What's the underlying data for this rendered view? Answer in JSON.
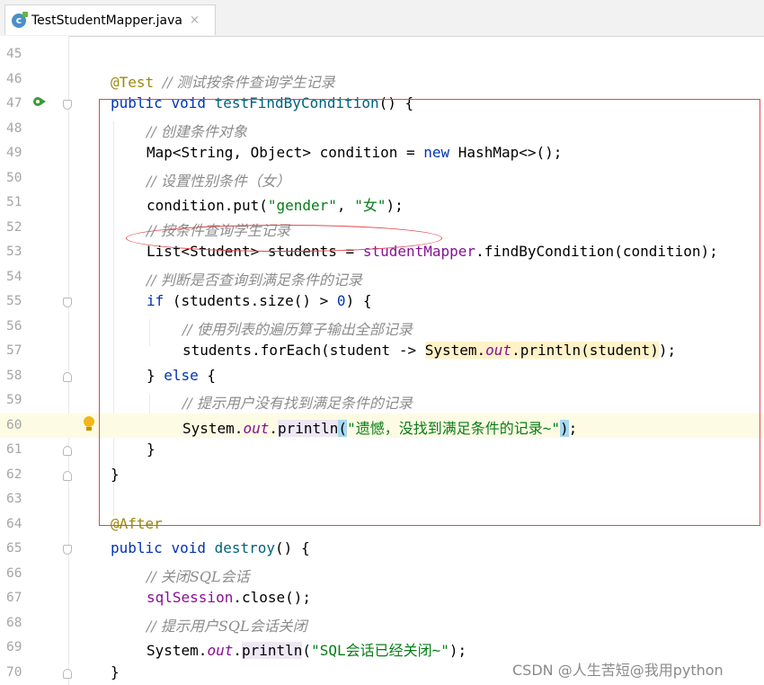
{
  "tab": {
    "filename": "TestStudentMapper.java",
    "icon_letter": "c",
    "close": "×"
  },
  "code": {
    "l46": {
      "num": "45"
    },
    "l47": {
      "num": "46",
      "ann": "@Test",
      "cmt": "// 测试按条件查询学生记录"
    },
    "l48": {
      "num": "47",
      "kw1": "public",
      "kw2": "void",
      "fn": "testFindByCondition",
      "rest": "() {"
    },
    "l49": {
      "num": "48",
      "cmt": "// 创建条件对象"
    },
    "l50": {
      "num": "49",
      "p1": "Map<String, Object> condition = ",
      "kw": "new",
      "p2": " HashMap<>();"
    },
    "l51": {
      "num": "50",
      "cmt": "// 设置性别条件（女）"
    },
    "l52": {
      "num": "51",
      "p1": "condition.put(",
      "s1": "\"gender\"",
      "p2": ", ",
      "s2": "\"女\"",
      "p3": ");"
    },
    "l53": {
      "num": "52",
      "cmt": "// 按条件查询学生记录"
    },
    "l54": {
      "num": "53",
      "p1": "List<Student> students = ",
      "fld": "studentMapper",
      "p2": ".findByCondition(condition);"
    },
    "l55": {
      "num": "54",
      "cmt": "// 判断是否查询到满足条件的记录"
    },
    "l56": {
      "num": "55",
      "kw": "if",
      "p1": " (students.size() > ",
      "n": "0",
      "p2": ") {"
    },
    "l57": {
      "num": "56",
      "cmt": "// 使用列表的遍历算子输出全部记录"
    },
    "l58": {
      "num": "57",
      "p1": "students.forEach(student -> ",
      "h1": "System.",
      "h2": "out",
      "h3": ".println(student)",
      "p2": ");"
    },
    "l59": {
      "num": "58",
      "p1": "} ",
      "kw": "else",
      "p2": " {"
    },
    "l60": {
      "num": "59",
      "cmt": "// 提示用户没有找到满足条件的记录"
    },
    "l61": {
      "num": "60",
      "p1": "System.",
      "fld": "out",
      "p2": ".",
      "pl": "println",
      "lp": "(",
      "s": "\"遗憾，没找到满足条件的记录~\"",
      "rp": ")",
      "p3": ";"
    },
    "l62": {
      "num": "61",
      "p1": "}"
    },
    "l63": {
      "num": "62",
      "p1": "}"
    },
    "l64": {
      "num": "63"
    },
    "l65": {
      "num": "64",
      "ann": "@After"
    },
    "l66": {
      "num": "65",
      "kw1": "public",
      "kw2": "void",
      "fn": "destroy",
      "rest": "() {"
    },
    "l67": {
      "num": "66",
      "cmt": "// 关闭SQL会话"
    },
    "l68": {
      "num": "67",
      "fld": "sqlSession",
      "p1": ".close();"
    },
    "l69": {
      "num": "68",
      "cmt": "// 提示用户SQL会话关闭"
    },
    "l70": {
      "num": "69",
      "p1": "System.",
      "fld": "out",
      "p2": ".",
      "pl": "println",
      "p3": "(",
      "s": "\"SQL会话已经关闭~\"",
      "p4": ");"
    },
    "l71": {
      "num": "70",
      "p1": "}"
    }
  },
  "watermark": "CSDN @人生苦短@我用python"
}
